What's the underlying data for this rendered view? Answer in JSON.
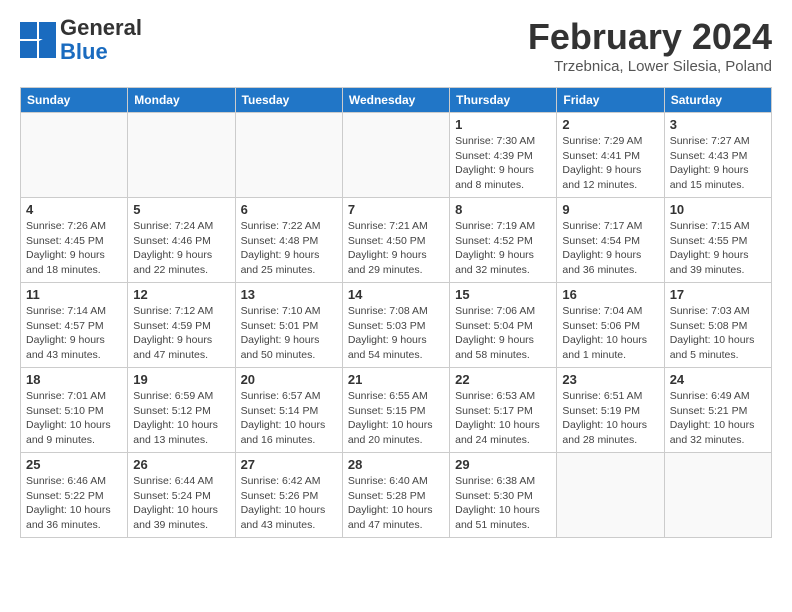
{
  "logo": {
    "general": "General",
    "blue": "Blue"
  },
  "header": {
    "month": "February 2024",
    "location": "Trzebnica, Lower Silesia, Poland"
  },
  "weekdays": [
    "Sunday",
    "Monday",
    "Tuesday",
    "Wednesday",
    "Thursday",
    "Friday",
    "Saturday"
  ],
  "weeks": [
    [
      {
        "day": "",
        "info": ""
      },
      {
        "day": "",
        "info": ""
      },
      {
        "day": "",
        "info": ""
      },
      {
        "day": "",
        "info": ""
      },
      {
        "day": "1",
        "info": "Sunrise: 7:30 AM\nSunset: 4:39 PM\nDaylight: 9 hours\nand 8 minutes."
      },
      {
        "day": "2",
        "info": "Sunrise: 7:29 AM\nSunset: 4:41 PM\nDaylight: 9 hours\nand 12 minutes."
      },
      {
        "day": "3",
        "info": "Sunrise: 7:27 AM\nSunset: 4:43 PM\nDaylight: 9 hours\nand 15 minutes."
      }
    ],
    [
      {
        "day": "4",
        "info": "Sunrise: 7:26 AM\nSunset: 4:45 PM\nDaylight: 9 hours\nand 18 minutes."
      },
      {
        "day": "5",
        "info": "Sunrise: 7:24 AM\nSunset: 4:46 PM\nDaylight: 9 hours\nand 22 minutes."
      },
      {
        "day": "6",
        "info": "Sunrise: 7:22 AM\nSunset: 4:48 PM\nDaylight: 9 hours\nand 25 minutes."
      },
      {
        "day": "7",
        "info": "Sunrise: 7:21 AM\nSunset: 4:50 PM\nDaylight: 9 hours\nand 29 minutes."
      },
      {
        "day": "8",
        "info": "Sunrise: 7:19 AM\nSunset: 4:52 PM\nDaylight: 9 hours\nand 32 minutes."
      },
      {
        "day": "9",
        "info": "Sunrise: 7:17 AM\nSunset: 4:54 PM\nDaylight: 9 hours\nand 36 minutes."
      },
      {
        "day": "10",
        "info": "Sunrise: 7:15 AM\nSunset: 4:55 PM\nDaylight: 9 hours\nand 39 minutes."
      }
    ],
    [
      {
        "day": "11",
        "info": "Sunrise: 7:14 AM\nSunset: 4:57 PM\nDaylight: 9 hours\nand 43 minutes."
      },
      {
        "day": "12",
        "info": "Sunrise: 7:12 AM\nSunset: 4:59 PM\nDaylight: 9 hours\nand 47 minutes."
      },
      {
        "day": "13",
        "info": "Sunrise: 7:10 AM\nSunset: 5:01 PM\nDaylight: 9 hours\nand 50 minutes."
      },
      {
        "day": "14",
        "info": "Sunrise: 7:08 AM\nSunset: 5:03 PM\nDaylight: 9 hours\nand 54 minutes."
      },
      {
        "day": "15",
        "info": "Sunrise: 7:06 AM\nSunset: 5:04 PM\nDaylight: 9 hours\nand 58 minutes."
      },
      {
        "day": "16",
        "info": "Sunrise: 7:04 AM\nSunset: 5:06 PM\nDaylight: 10 hours\nand 1 minute."
      },
      {
        "day": "17",
        "info": "Sunrise: 7:03 AM\nSunset: 5:08 PM\nDaylight: 10 hours\nand 5 minutes."
      }
    ],
    [
      {
        "day": "18",
        "info": "Sunrise: 7:01 AM\nSunset: 5:10 PM\nDaylight: 10 hours\nand 9 minutes."
      },
      {
        "day": "19",
        "info": "Sunrise: 6:59 AM\nSunset: 5:12 PM\nDaylight: 10 hours\nand 13 minutes."
      },
      {
        "day": "20",
        "info": "Sunrise: 6:57 AM\nSunset: 5:14 PM\nDaylight: 10 hours\nand 16 minutes."
      },
      {
        "day": "21",
        "info": "Sunrise: 6:55 AM\nSunset: 5:15 PM\nDaylight: 10 hours\nand 20 minutes."
      },
      {
        "day": "22",
        "info": "Sunrise: 6:53 AM\nSunset: 5:17 PM\nDaylight: 10 hours\nand 24 minutes."
      },
      {
        "day": "23",
        "info": "Sunrise: 6:51 AM\nSunset: 5:19 PM\nDaylight: 10 hours\nand 28 minutes."
      },
      {
        "day": "24",
        "info": "Sunrise: 6:49 AM\nSunset: 5:21 PM\nDaylight: 10 hours\nand 32 minutes."
      }
    ],
    [
      {
        "day": "25",
        "info": "Sunrise: 6:46 AM\nSunset: 5:22 PM\nDaylight: 10 hours\nand 36 minutes."
      },
      {
        "day": "26",
        "info": "Sunrise: 6:44 AM\nSunset: 5:24 PM\nDaylight: 10 hours\nand 39 minutes."
      },
      {
        "day": "27",
        "info": "Sunrise: 6:42 AM\nSunset: 5:26 PM\nDaylight: 10 hours\nand 43 minutes."
      },
      {
        "day": "28",
        "info": "Sunrise: 6:40 AM\nSunset: 5:28 PM\nDaylight: 10 hours\nand 47 minutes."
      },
      {
        "day": "29",
        "info": "Sunrise: 6:38 AM\nSunset: 5:30 PM\nDaylight: 10 hours\nand 51 minutes."
      },
      {
        "day": "",
        "info": ""
      },
      {
        "day": "",
        "info": ""
      }
    ]
  ]
}
